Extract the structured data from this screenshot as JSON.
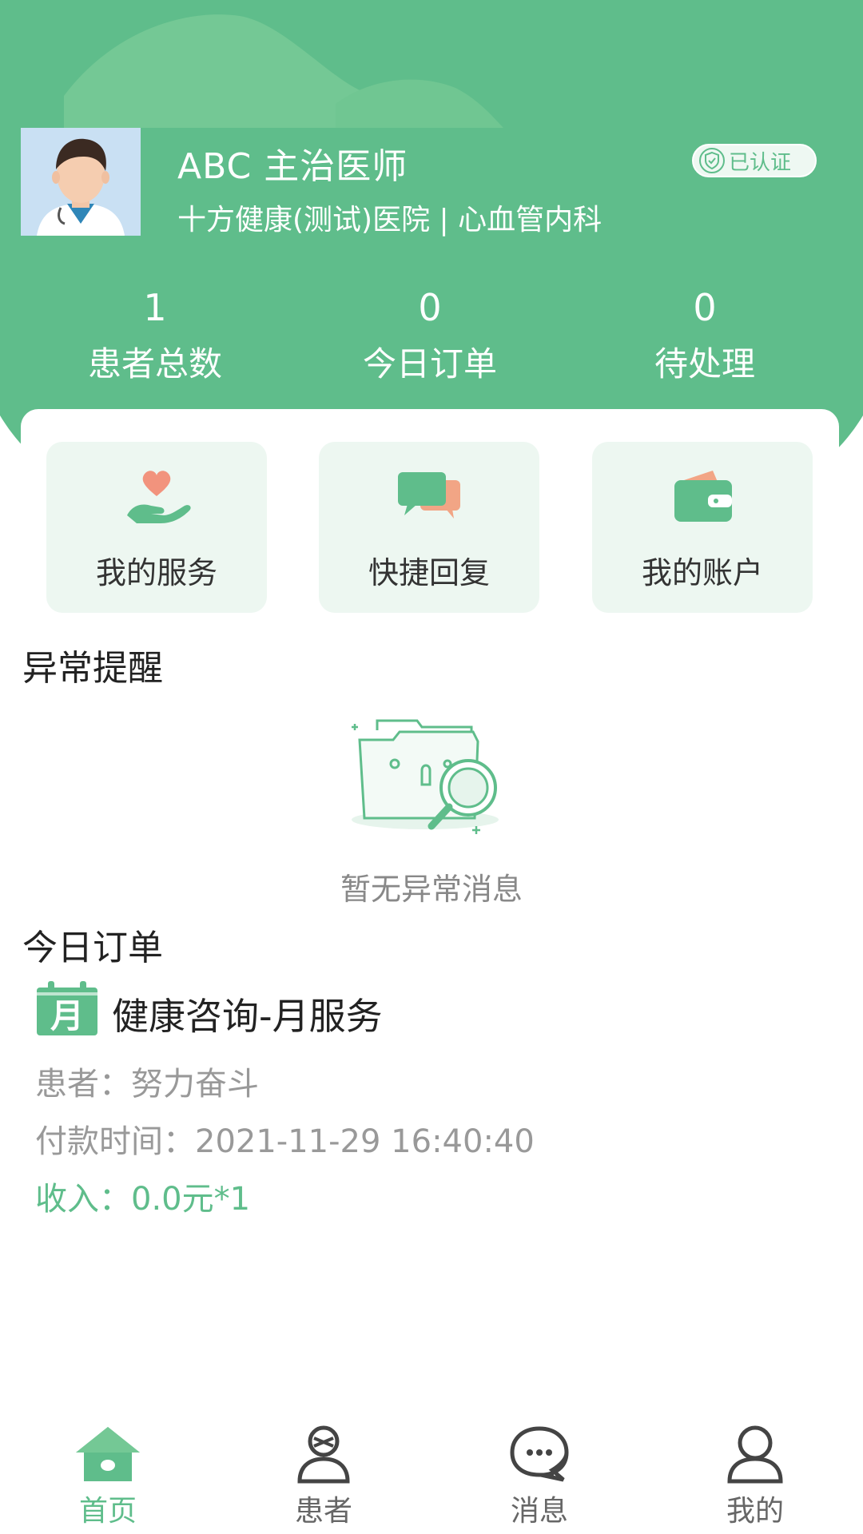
{
  "colors": {
    "accent": "#5fbd8b",
    "accent_light": "#edf7f1",
    "muted": "#999999"
  },
  "profile": {
    "name": "ABC 主治医师",
    "hospital": "十方健康(测试)医院 | 心血管内科",
    "badge": "已认证"
  },
  "stats": [
    {
      "value": "1",
      "label": "患者总数"
    },
    {
      "value": "0",
      "label": "今日订单"
    },
    {
      "value": "0",
      "label": "待处理"
    }
  ],
  "quick_actions": [
    {
      "label": "我的服务",
      "icon": "heart-hand-icon"
    },
    {
      "label": "快捷回复",
      "icon": "chat-bubbles-icon"
    },
    {
      "label": "我的账户",
      "icon": "wallet-icon"
    }
  ],
  "alerts": {
    "title": "异常提醒",
    "empty_text": "暂无异常消息"
  },
  "orders": {
    "title": "今日订单",
    "items": [
      {
        "icon_text": "月",
        "title": "健康咨询-月服务",
        "patient": "患者：努力奋斗",
        "paid_time": "付款时间：2021-11-29 16:40:40",
        "income": "收入：0.0元*1"
      }
    ]
  },
  "tabbar": [
    {
      "label": "首页",
      "icon": "home-icon",
      "active": true
    },
    {
      "label": "患者",
      "icon": "patient-icon",
      "active": false
    },
    {
      "label": "消息",
      "icon": "message-icon",
      "active": false
    },
    {
      "label": "我的",
      "icon": "person-icon",
      "active": false
    }
  ]
}
